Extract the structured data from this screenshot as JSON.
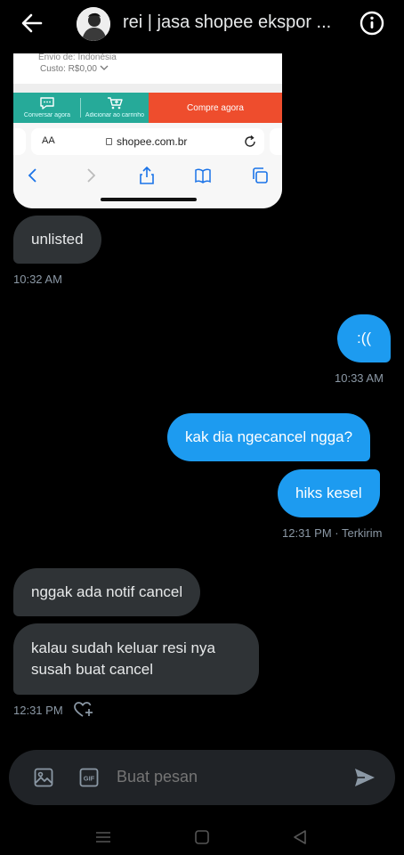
{
  "header": {
    "title": "rei | jasa shopee ekspor ...",
    "icons": {
      "back": "arrow-left-icon",
      "info": "info-icon"
    }
  },
  "screenshot": {
    "shipping_line": "Envio de: Indonésia",
    "cost_line": "Custo: R$0,00",
    "chat_label": "Conversar agora",
    "cart_label": "Adicionar ao carrinho",
    "buy_label": "Compre agora",
    "aa_label": "AA",
    "url": "shopee.com.br",
    "colors": {
      "teal": "#26aa99",
      "orange": "#ee4d2d"
    }
  },
  "messages": [
    {
      "side": "in",
      "text": "unlisted"
    },
    {
      "side": "meta",
      "text": "10:32 AM"
    },
    {
      "side": "out",
      "text": ":(("
    },
    {
      "side": "meta",
      "text": "10:33 AM"
    },
    {
      "side": "out",
      "text": "kak dia ngecancel ngga?"
    },
    {
      "side": "out",
      "text": "hiks kesel"
    },
    {
      "side": "meta",
      "text": "12:31 PM · Terkirim"
    },
    {
      "side": "in",
      "text": "nggak ada notif cancel"
    },
    {
      "side": "in",
      "text": "kalau sudah keluar resi nya susah buat cancel"
    },
    {
      "side": "meta",
      "text": "12:31 PM"
    }
  ],
  "composer": {
    "placeholder": "Buat pesan",
    "icons": [
      "image-icon",
      "gif-icon",
      "send-icon"
    ]
  },
  "colors": {
    "background": "#000000",
    "incoming_bubble": "#2f3336",
    "outgoing_bubble": "#1d9bf0",
    "composer": "#202327",
    "meta_text": "#8b98a5"
  }
}
